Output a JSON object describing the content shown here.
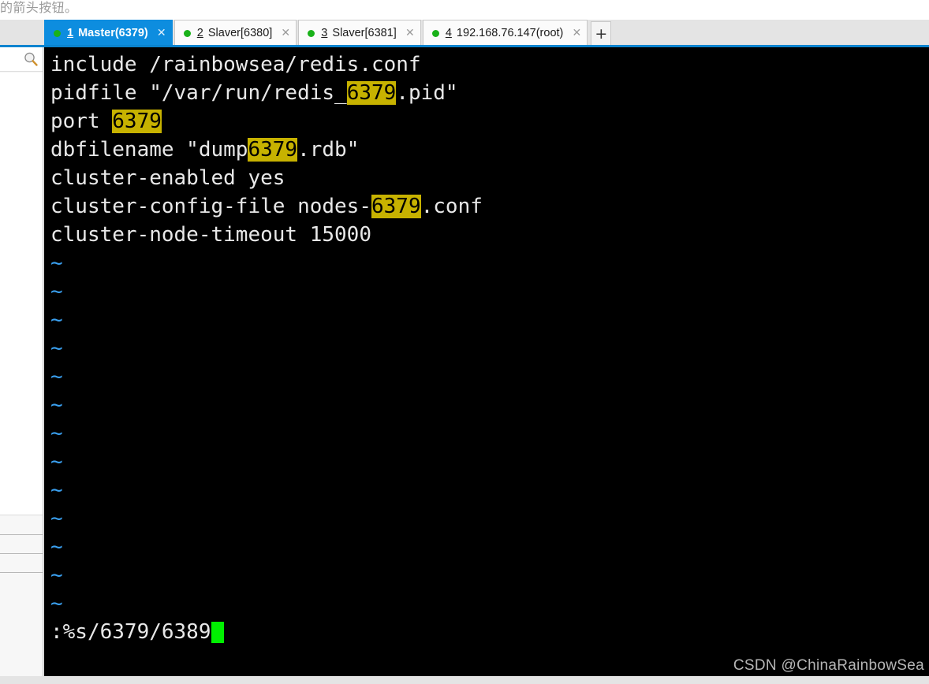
{
  "page": {
    "top_text": "的箭头按钮。",
    "watermark": "CSDN @ChinaRainbowSea"
  },
  "panel_controls": {
    "pin_icon": "pin-icon",
    "pin_glyph": "⚲",
    "close_icon": "close-icon",
    "close_glyph": "✕"
  },
  "tabbar": {
    "accent_color": "#0a84cf",
    "active_tab_bg": "#0d8ddf",
    "status_dot_color": "#1ab21a",
    "new_tab_label": "+",
    "tabs": [
      {
        "num": "1",
        "title": " Master(6379)",
        "active": true,
        "close": "✕"
      },
      {
        "num": "2",
        "title": " Slaver[6380]",
        "active": false,
        "close": "✕"
      },
      {
        "num": "3",
        "title": " Slaver[6381]",
        "active": false,
        "close": "✕"
      },
      {
        "num": "4",
        "title": " 192.168.76.147(root)",
        "active": false,
        "close": "✕"
      }
    ]
  },
  "sidebar": {
    "search_icon": "search-icon",
    "search_placeholder": ""
  },
  "terminal": {
    "background": "#000000",
    "foreground": "#e8e8e8",
    "highlight_bg": "#c7b200",
    "highlight_fg": "#000000",
    "tilde_color": "#3aa0f0",
    "cursor_color": "#00f000",
    "tilde_glyph": "~",
    "tilde_count": 13,
    "lines": [
      [
        {
          "t": "include /rainbowsea/redis.conf",
          "h": false
        }
      ],
      [
        {
          "t": "pidfile \"/var/run/redis_",
          "h": false
        },
        {
          "t": "6379",
          "h": true
        },
        {
          "t": ".pid\"",
          "h": false
        }
      ],
      [
        {
          "t": "port ",
          "h": false
        },
        {
          "t": "6379",
          "h": true
        }
      ],
      [
        {
          "t": "dbfilename \"dump",
          "h": false
        },
        {
          "t": "6379",
          "h": true
        },
        {
          "t": ".rdb\"",
          "h": false
        }
      ],
      [
        {
          "t": "cluster-enabled yes",
          "h": false
        }
      ],
      [
        {
          "t": "cluster-config-file nodes-",
          "h": false
        },
        {
          "t": "6379",
          "h": true
        },
        {
          "t": ".conf",
          "h": false
        }
      ],
      [
        {
          "t": "cluster-node-timeout 15000",
          "h": false
        }
      ]
    ],
    "command_line": ":%s/6379/6389"
  }
}
